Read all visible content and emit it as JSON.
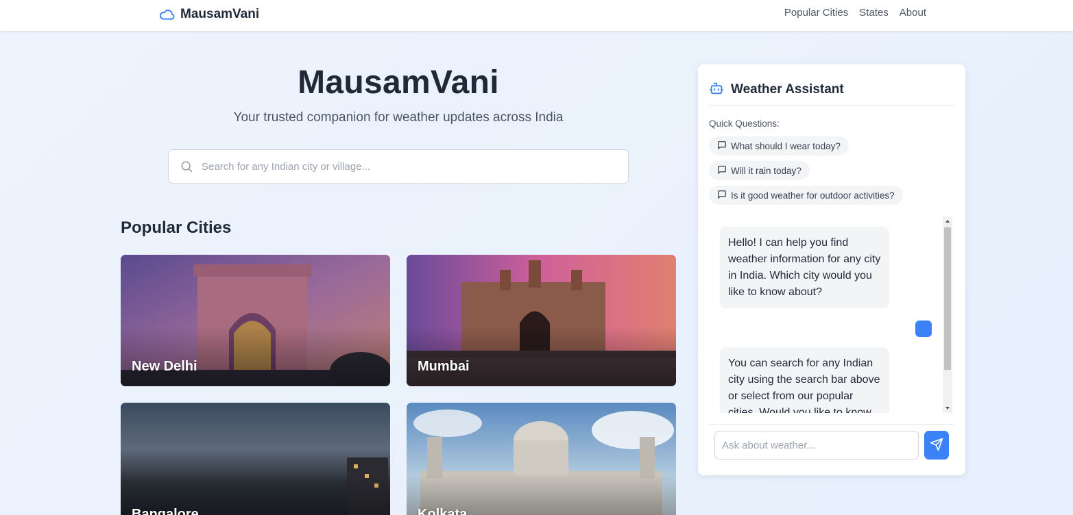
{
  "colors": {
    "accent": "#3b82f6",
    "text_dark": "#1f2937",
    "text_muted": "#4b5563",
    "page_background": "#eaf1fc"
  },
  "navbar": {
    "brand": "MausamVani",
    "brand_icon": "cloud-icon",
    "links": [
      "Popular Cities",
      "States",
      "About"
    ]
  },
  "hero": {
    "title": "MausamVani",
    "subtitle": "Your trusted companion for weather updates across India",
    "search_placeholder": "Search for any Indian city or village...",
    "search_icon": "search-icon"
  },
  "popular": {
    "title": "Popular Cities",
    "cities": [
      "New Delhi",
      "Mumbai",
      "Bangalore",
      "Kolkata"
    ]
  },
  "assistant": {
    "title": "Weather Assistant",
    "icon": "bot-icon",
    "quick_label": "Quick Questions:",
    "quick_questions": [
      "What should I wear today?",
      "Will it rain today?",
      "Is it good weather for outdoor activities?"
    ],
    "messages": [
      {
        "sender": "bot",
        "text": "Hello! I can help you find weather information for any city in India. Which city would you like to know about?"
      },
      {
        "sender": "user",
        "text": ""
      },
      {
        "sender": "bot",
        "text": "You can search for any Indian city using the search bar above or select from our popular cities. Would you like to know"
      }
    ],
    "input_placeholder": "Ask about weather...",
    "send_icon": "send-icon"
  }
}
